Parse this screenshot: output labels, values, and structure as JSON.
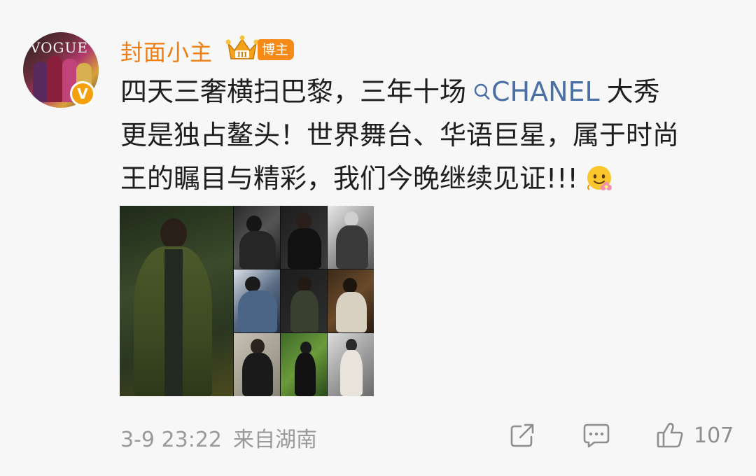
{
  "post": {
    "author": {
      "name": "封面小主",
      "badge_label": "博主",
      "crown_level": "III",
      "avatar_text": "VOGUE",
      "verified_mark": "V"
    },
    "content": {
      "segment_1": "四天三奢横扫巴黎，三年十场",
      "topic_label": "CHANEL",
      "segment_2": "大秀",
      "line_2": "更是独占鳌头！世界舞台、华语巨星，属于时尚",
      "line_3": "王的瞩目与精彩，我们今晚继续见证!!!"
    },
    "meta": {
      "timestamp": "3-9 23:22",
      "source": "来自湖南"
    },
    "actions": {
      "like_count": "107"
    }
  },
  "colors": {
    "username": "#ef7e10",
    "badge": "#f58b16",
    "topic_link": "#4a6fa5",
    "meta_text": "#9a9a9a",
    "background": "#f7f7f7"
  },
  "icons": {
    "crown": "crown-icon",
    "verified": "verified-icon",
    "topic": "search-icon",
    "emoji": "flower-face-emoji",
    "share": "share-icon",
    "comment": "comment-icon",
    "like": "thumbs-up-icon"
  }
}
